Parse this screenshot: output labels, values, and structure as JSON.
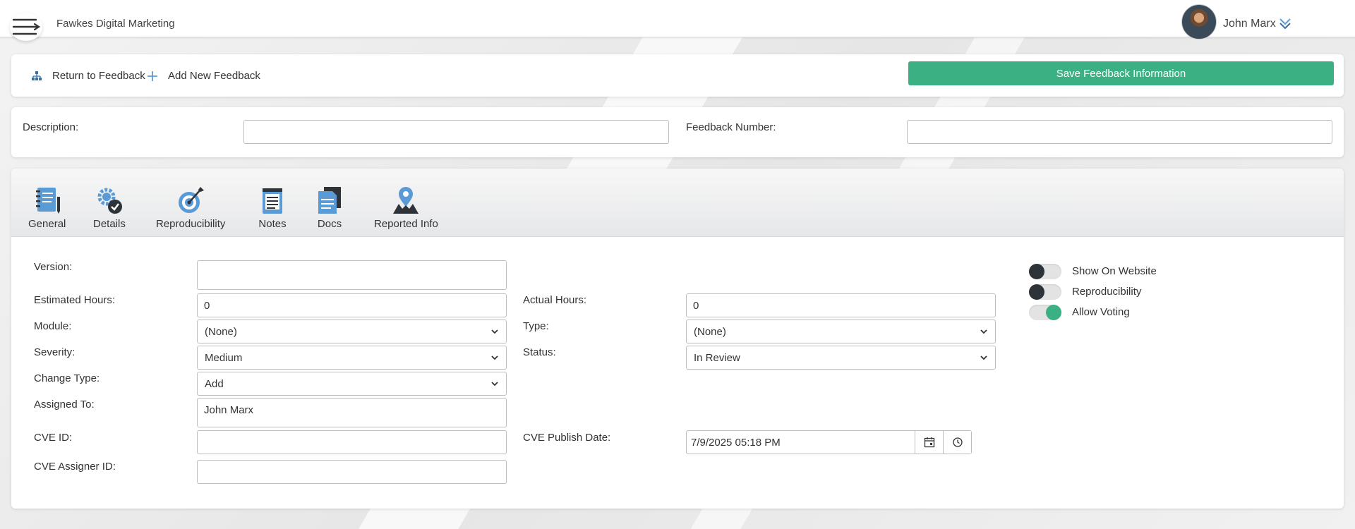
{
  "header": {
    "company": "Fawkes Digital Marketing",
    "user_name": "John Marx",
    "icons": [
      "menu-icon",
      "chevron-down-icon"
    ]
  },
  "actions": {
    "return_label": "Return to Feedback",
    "add_label": "Add New Feedback",
    "save_label": "Save Feedback Information"
  },
  "desc": {
    "description_label": "Description:",
    "description_value": "",
    "feedback_number_label": "Feedback Number:",
    "feedback_number_value": ""
  },
  "tabs": [
    {
      "label": "General",
      "icon": "notebook-icon"
    },
    {
      "label": "Details",
      "icon": "gear-check-icon"
    },
    {
      "label": "Reproducibility",
      "icon": "target-icon"
    },
    {
      "label": "Notes",
      "icon": "notepad-icon"
    },
    {
      "label": "Docs",
      "icon": "documents-icon"
    },
    {
      "label": "Reported Info",
      "icon": "location-pin-icon"
    }
  ],
  "form": {
    "version_label": "Version:",
    "version_value": "",
    "estimated_hours_label": "Estimated Hours:",
    "estimated_hours_value": "0",
    "actual_hours_label": "Actual Hours:",
    "actual_hours_value": "0",
    "module_label": "Module:",
    "module_value": "(None)",
    "type_label": "Type:",
    "type_value": "(None)",
    "severity_label": "Severity:",
    "severity_value": "Medium",
    "status_label": "Status:",
    "status_value": "In Review",
    "change_type_label": "Change Type:",
    "change_type_value": "Add",
    "assigned_to_label": "Assigned To:",
    "assigned_to_value": "John Marx",
    "cve_id_label": "CVE ID:",
    "cve_id_value": "",
    "cve_publish_date_label": "CVE Publish Date:",
    "cve_publish_date_value": "7/9/2025 05:18 PM",
    "cve_assigner_label": "CVE Assigner ID:",
    "cve_assigner_value": ""
  },
  "toggles": [
    {
      "label": "Show On Website",
      "on": false
    },
    {
      "label": "Reproducibility",
      "on": false
    },
    {
      "label": "Allow Voting",
      "on": true
    }
  ],
  "colors": {
    "accent": "#3bb083",
    "toggle_off_knob": "#2d3339",
    "icon_blue": "#5b9bd5"
  }
}
